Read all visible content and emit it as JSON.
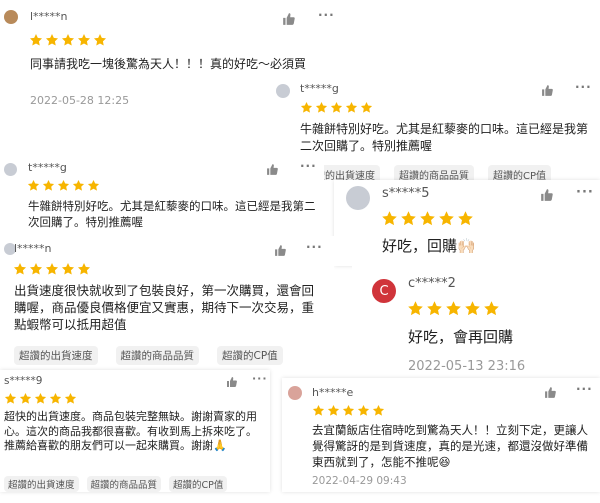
{
  "colors": {
    "star": "#f7b500",
    "text": "#222222",
    "muted": "#999999",
    "tag_bg": "#f1f1f1",
    "avatar_c": "#d0343a"
  },
  "icons": {
    "like": "thumbs-up-icon",
    "more": "more-icon",
    "rating": "star-icon"
  },
  "rating_stars": 5,
  "reviews": [
    {
      "user": "l*****n",
      "text": "同事請我吃一塊後驚為天人！！！真的好吃～必須買",
      "date": "2022-05-28 12:25"
    },
    {
      "user": "t*****g",
      "text": "牛雜餅特別好吃。尤其是紅藜麥的口味。這已經是我第二次回購了。特別推薦喔",
      "tags": [
        "超讚的出貨速度",
        "超讚的商品品質",
        "超讚的CP值"
      ]
    },
    {
      "user": "t*****g",
      "text": "牛雜餅特別好吃。尤其是紅藜麥的口味。這已經是我第二次回購了。特別推薦喔"
    },
    {
      "user": "s*****5",
      "text": "好吃，回購🙌🏻"
    },
    {
      "user": "l*****n",
      "text": "出貨速度很快就收到了包裝良好，第一次購買，還會回購喔，商品優良價格便宜又實惠，期待下一次交易，重點蝦幣可以抵用超值",
      "tags": [
        "超讚的出貨速度",
        "超讚的商品品質",
        "超讚的CP值"
      ]
    },
    {
      "user": "c*****2",
      "avatar_letter": "C",
      "text": "好吃，會再回購",
      "date": "2022-05-13 23:16"
    },
    {
      "user": "s*****9",
      "text": "超快的出貨速度。商品包裝完整無缺。謝謝賣家的用心。這次的商品我都很喜歡。有收到馬上拆來吃了。推薦給喜歡的朋友們可以一起來購買。謝謝🙏",
      "tags": [
        "超讚的出貨速度",
        "超讚的商品品質",
        "超讚的CP值"
      ]
    },
    {
      "user": "h*****e",
      "text": "去宜蘭飯店住宿時吃到驚為天人！！立刻下定，更讓人覺得驚訝的是到貨速度，真的是光速，都還沒做好準備東西就到了，怎能不推呢😆",
      "date": "2022-04-29 09:43"
    }
  ]
}
